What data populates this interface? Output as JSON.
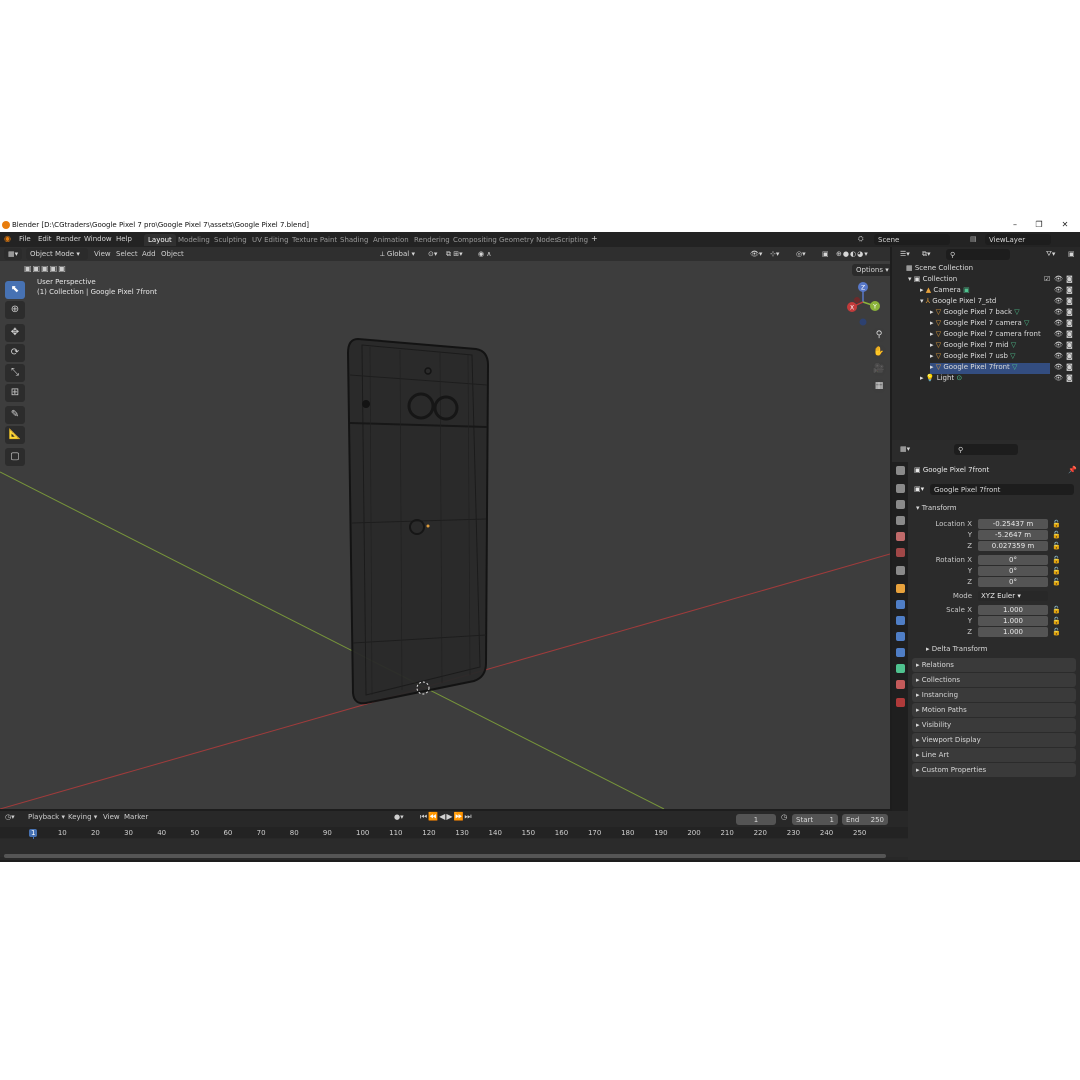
{
  "window": {
    "title": "Blender [D:\\CGtraders\\Google Pixel 7 pro\\Google Pixel 7\\assets\\Google Pixel 7.blend]",
    "minimize": "–",
    "maximize": "❐",
    "close": "✕"
  },
  "menus": [
    "File",
    "Edit",
    "Render",
    "Window",
    "Help"
  ],
  "workspaces": [
    {
      "label": "Layout",
      "active": true
    },
    {
      "label": "Modeling"
    },
    {
      "label": "Sculpting"
    },
    {
      "label": "UV Editing"
    },
    {
      "label": "Texture Paint"
    },
    {
      "label": "Shading"
    },
    {
      "label": "Animation"
    },
    {
      "label": "Rendering"
    },
    {
      "label": "Compositing"
    },
    {
      "label": "Geometry Nodes"
    },
    {
      "label": "Scripting"
    }
  ],
  "add_workspace": "+",
  "scene": {
    "label": "Scene",
    "view_layer": "ViewLayer"
  },
  "viewport": {
    "mode": "Object Mode",
    "menus": [
      "View",
      "Select",
      "Add",
      "Object"
    ],
    "transform_orientation": "Global",
    "options_label": "Options",
    "perspective": "User Perspective",
    "collection_info": "(1) Collection | Google Pixel 7front",
    "gizmo": {
      "z": "Z",
      "y": "Y",
      "x": "X"
    }
  },
  "outliner": {
    "root": "Scene Collection",
    "collection": "Collection",
    "items": [
      {
        "name": "Camera",
        "indent": 1
      },
      {
        "name": "Google Pixel 7_std",
        "indent": 1
      },
      {
        "name": "Google Pixel 7 back",
        "indent": 2
      },
      {
        "name": "Google Pixel 7 camera",
        "indent": 2
      },
      {
        "name": "Google Pixel 7 camera front",
        "indent": 2
      },
      {
        "name": "Google Pixel 7 mid",
        "indent": 2
      },
      {
        "name": "Google Pixel 7 usb",
        "indent": 2
      },
      {
        "name": "Google Pixel 7front",
        "indent": 2
      },
      {
        "name": "Light",
        "indent": 1
      }
    ]
  },
  "properties": {
    "object_name": "Google Pixel 7front",
    "object_field": "Google Pixel 7front",
    "transform_label": "Transform",
    "location": {
      "label": "Location X",
      "x": "-0.25437 m",
      "y": "-5.2647 m",
      "z": "0.027359 m"
    },
    "rotation": {
      "label": "Rotation X",
      "x": "0°",
      "y": "0°",
      "z": "0°"
    },
    "mode": {
      "label": "Mode",
      "value": "XYZ Euler"
    },
    "scale": {
      "label": "Scale X",
      "x": "1.000",
      "y": "1.000",
      "z": "1.000"
    },
    "axis_y": "Y",
    "axis_z": "Z",
    "panels": [
      "Delta Transform",
      "Relations",
      "Collections",
      "Instancing",
      "Motion Paths",
      "Visibility",
      "Viewport Display",
      "Line Art",
      "Custom Properties"
    ]
  },
  "timeline": {
    "menus": [
      "Playback",
      "Keying",
      "View",
      "Marker"
    ],
    "current_frame": "1",
    "start_label": "Start",
    "start": "1",
    "end_label": "End",
    "end": "250",
    "ticks": [
      "1",
      "10",
      "20",
      "30",
      "40",
      "50",
      "60",
      "70",
      "80",
      "90",
      "100",
      "110",
      "120",
      "130",
      "140",
      "150",
      "160",
      "170",
      "180",
      "190",
      "200",
      "210",
      "220",
      "230",
      "240",
      "250"
    ]
  },
  "colors": {
    "accent": "#4772b3",
    "object_orange": "#e8a23c",
    "mesh_green": "#4fc28f",
    "x_axis": "#c23b3b",
    "y_axis": "#8bb33a",
    "viewport_bg": "#3d3d3d"
  }
}
